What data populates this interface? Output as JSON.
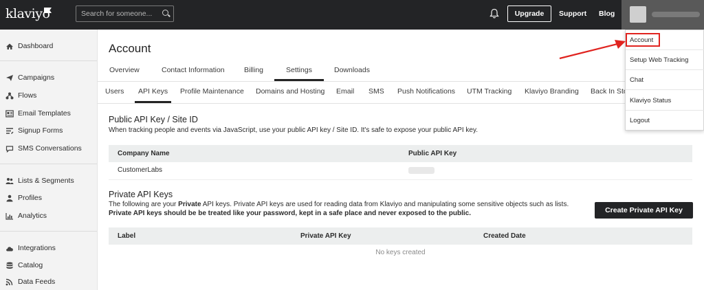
{
  "header": {
    "logo_text": "klaviyo",
    "search_placeholder": "Search for someone...",
    "upgrade_label": "Upgrade",
    "support_label": "Support",
    "blog_label": "Blog"
  },
  "sidebar": {
    "items": [
      {
        "label": "Dashboard",
        "icon": "home-icon"
      },
      {
        "label": "Campaigns",
        "icon": "paper-plane-icon"
      },
      {
        "label": "Flows",
        "icon": "flows-icon"
      },
      {
        "label": "Email Templates",
        "icon": "email-template-icon"
      },
      {
        "label": "Signup Forms",
        "icon": "signup-forms-icon"
      },
      {
        "label": "SMS Conversations",
        "icon": "sms-icon"
      },
      {
        "label": "Lists & Segments",
        "icon": "users-icon"
      },
      {
        "label": "Profiles",
        "icon": "profile-icon"
      },
      {
        "label": "Analytics",
        "icon": "analytics-icon"
      },
      {
        "label": "Integrations",
        "icon": "cloud-icon"
      },
      {
        "label": "Catalog",
        "icon": "database-icon"
      },
      {
        "label": "Data Feeds",
        "icon": "rss-icon"
      }
    ]
  },
  "page": {
    "title": "Account",
    "tabs": [
      "Overview",
      "Contact Information",
      "Billing",
      "Settings",
      "Downloads"
    ],
    "active_tab": "Settings",
    "subtabs": [
      "Users",
      "API Keys",
      "Profile Maintenance",
      "Domains and Hosting",
      "Email",
      "SMS",
      "Push Notifications",
      "UTM Tracking",
      "Klaviyo Branding",
      "Back In Sto"
    ],
    "active_subtab": "API Keys"
  },
  "public_section": {
    "title": "Public API Key / Site ID",
    "description": "When tracking people and events via JavaScript, use your public API key / Site ID. It's safe to expose your public API key.",
    "columns": [
      "Company Name",
      "Public API Key"
    ],
    "rows": [
      {
        "company": "CustomerLabs",
        "key": ""
      }
    ]
  },
  "private_section": {
    "title": "Private API Keys",
    "desc_prefix": "The following are your ",
    "desc_bold": "Private",
    "desc_suffix": " API keys. Private API keys are used for reading data from Klaviyo and manipulating some sensitive objects such as lists.",
    "warning": "Private API keys should be be treated like your password, kept in a safe place and never exposed to the public.",
    "create_button": "Create Private API Key",
    "columns": [
      "Label",
      "Private API Key",
      "Created Date"
    ],
    "empty_message": "No keys created"
  },
  "account_menu": {
    "items": [
      "Account",
      "Setup Web Tracking",
      "Chat",
      "Klaviyo Status",
      "Logout"
    ],
    "highlighted": "Account"
  },
  "colors": {
    "topbar": "#232426",
    "annotation_red": "#e0231f"
  }
}
